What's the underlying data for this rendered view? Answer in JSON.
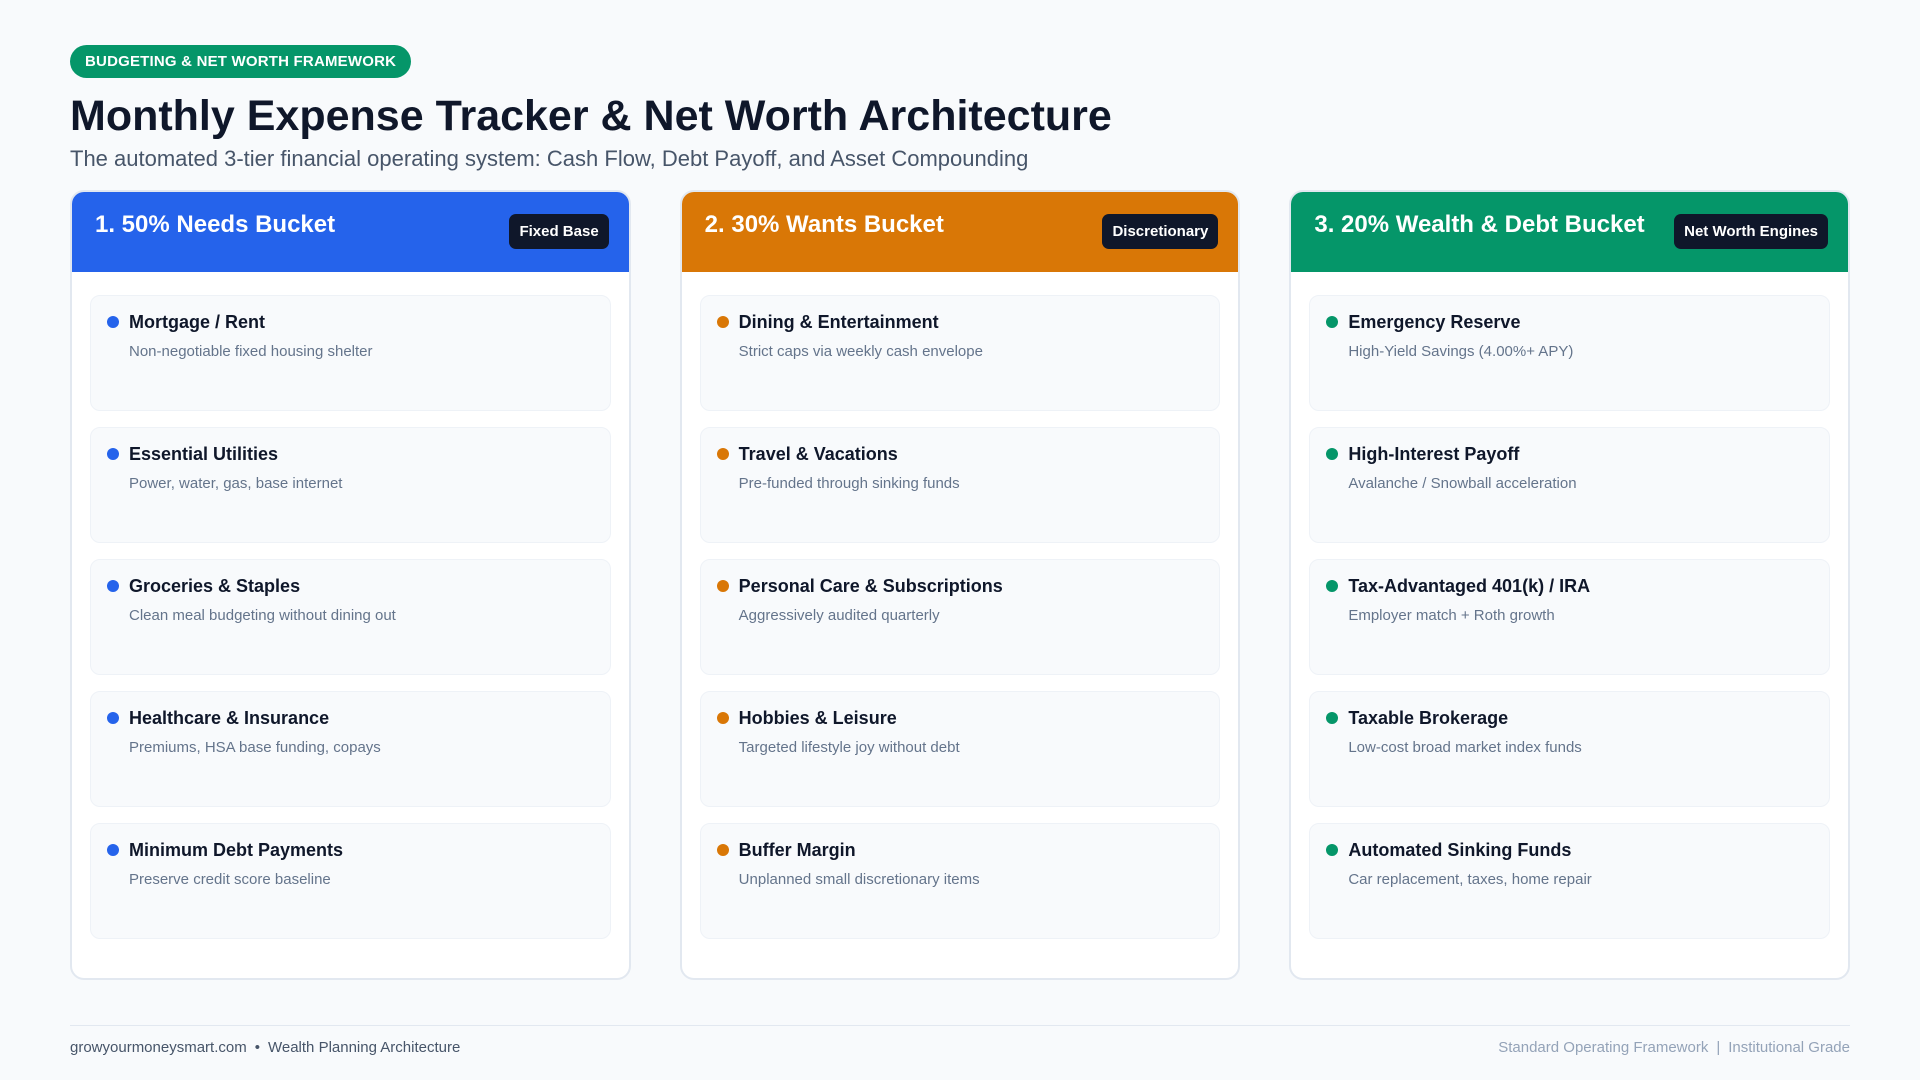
{
  "header": {
    "eyebrow": "BUDGETING & NET WORTH FRAMEWORK",
    "title": "Monthly Expense Tracker & Net Worth Architecture",
    "subtitle": "The automated 3-tier financial operating system: Cash Flow, Debt Payoff, and Asset Compounding"
  },
  "colors": {
    "eyebrow": "#059669",
    "needs": "#2563eb",
    "wants": "#d97706",
    "wealth": "#059669",
    "badge": "#0f172a"
  },
  "columns": [
    {
      "title": "1. 50% Needs Bucket",
      "badge": "Fixed Base",
      "items": [
        {
          "title": "Mortgage / Rent",
          "desc": "Non-negotiable fixed housing shelter"
        },
        {
          "title": "Essential Utilities",
          "desc": "Power, water, gas, base internet"
        },
        {
          "title": "Groceries & Staples",
          "desc": "Clean meal budgeting without dining out"
        },
        {
          "title": "Healthcare & Insurance",
          "desc": "Premiums, HSA base funding, copays"
        },
        {
          "title": "Minimum Debt Payments",
          "desc": "Preserve credit score baseline"
        }
      ]
    },
    {
      "title": "2. 30% Wants Bucket",
      "badge": "Discretionary",
      "items": [
        {
          "title": "Dining & Entertainment",
          "desc": "Strict caps via weekly cash envelope"
        },
        {
          "title": "Travel & Vacations",
          "desc": "Pre-funded through sinking funds"
        },
        {
          "title": "Personal Care & Subscriptions",
          "desc": "Aggressively audited quarterly"
        },
        {
          "title": "Hobbies & Leisure",
          "desc": "Targeted lifestyle joy without debt"
        },
        {
          "title": "Buffer Margin",
          "desc": "Unplanned small discretionary items"
        }
      ]
    },
    {
      "title": "3. 20% Wealth & Debt Bucket",
      "badge": "Net Worth Engines",
      "items": [
        {
          "title": "Emergency Reserve",
          "desc": "High-Yield Savings (4.00%+ APY)"
        },
        {
          "title": "High-Interest Payoff",
          "desc": "Avalanche / Snowball acceleration"
        },
        {
          "title": "Tax-Advantaged 401(k) / IRA",
          "desc": "Employer match + Roth growth"
        },
        {
          "title": "Taxable Brokerage",
          "desc": "Low-cost broad market index funds"
        },
        {
          "title": "Automated Sinking Funds",
          "desc": "Car replacement, taxes, home repair"
        }
      ]
    }
  ],
  "footer": {
    "site": "growyourmoneysmart.com",
    "bullet": "•",
    "tagline": "Wealth Planning Architecture",
    "right_a": "Standard Operating Framework",
    "divider": "|",
    "right_b": "Institutional Grade"
  }
}
